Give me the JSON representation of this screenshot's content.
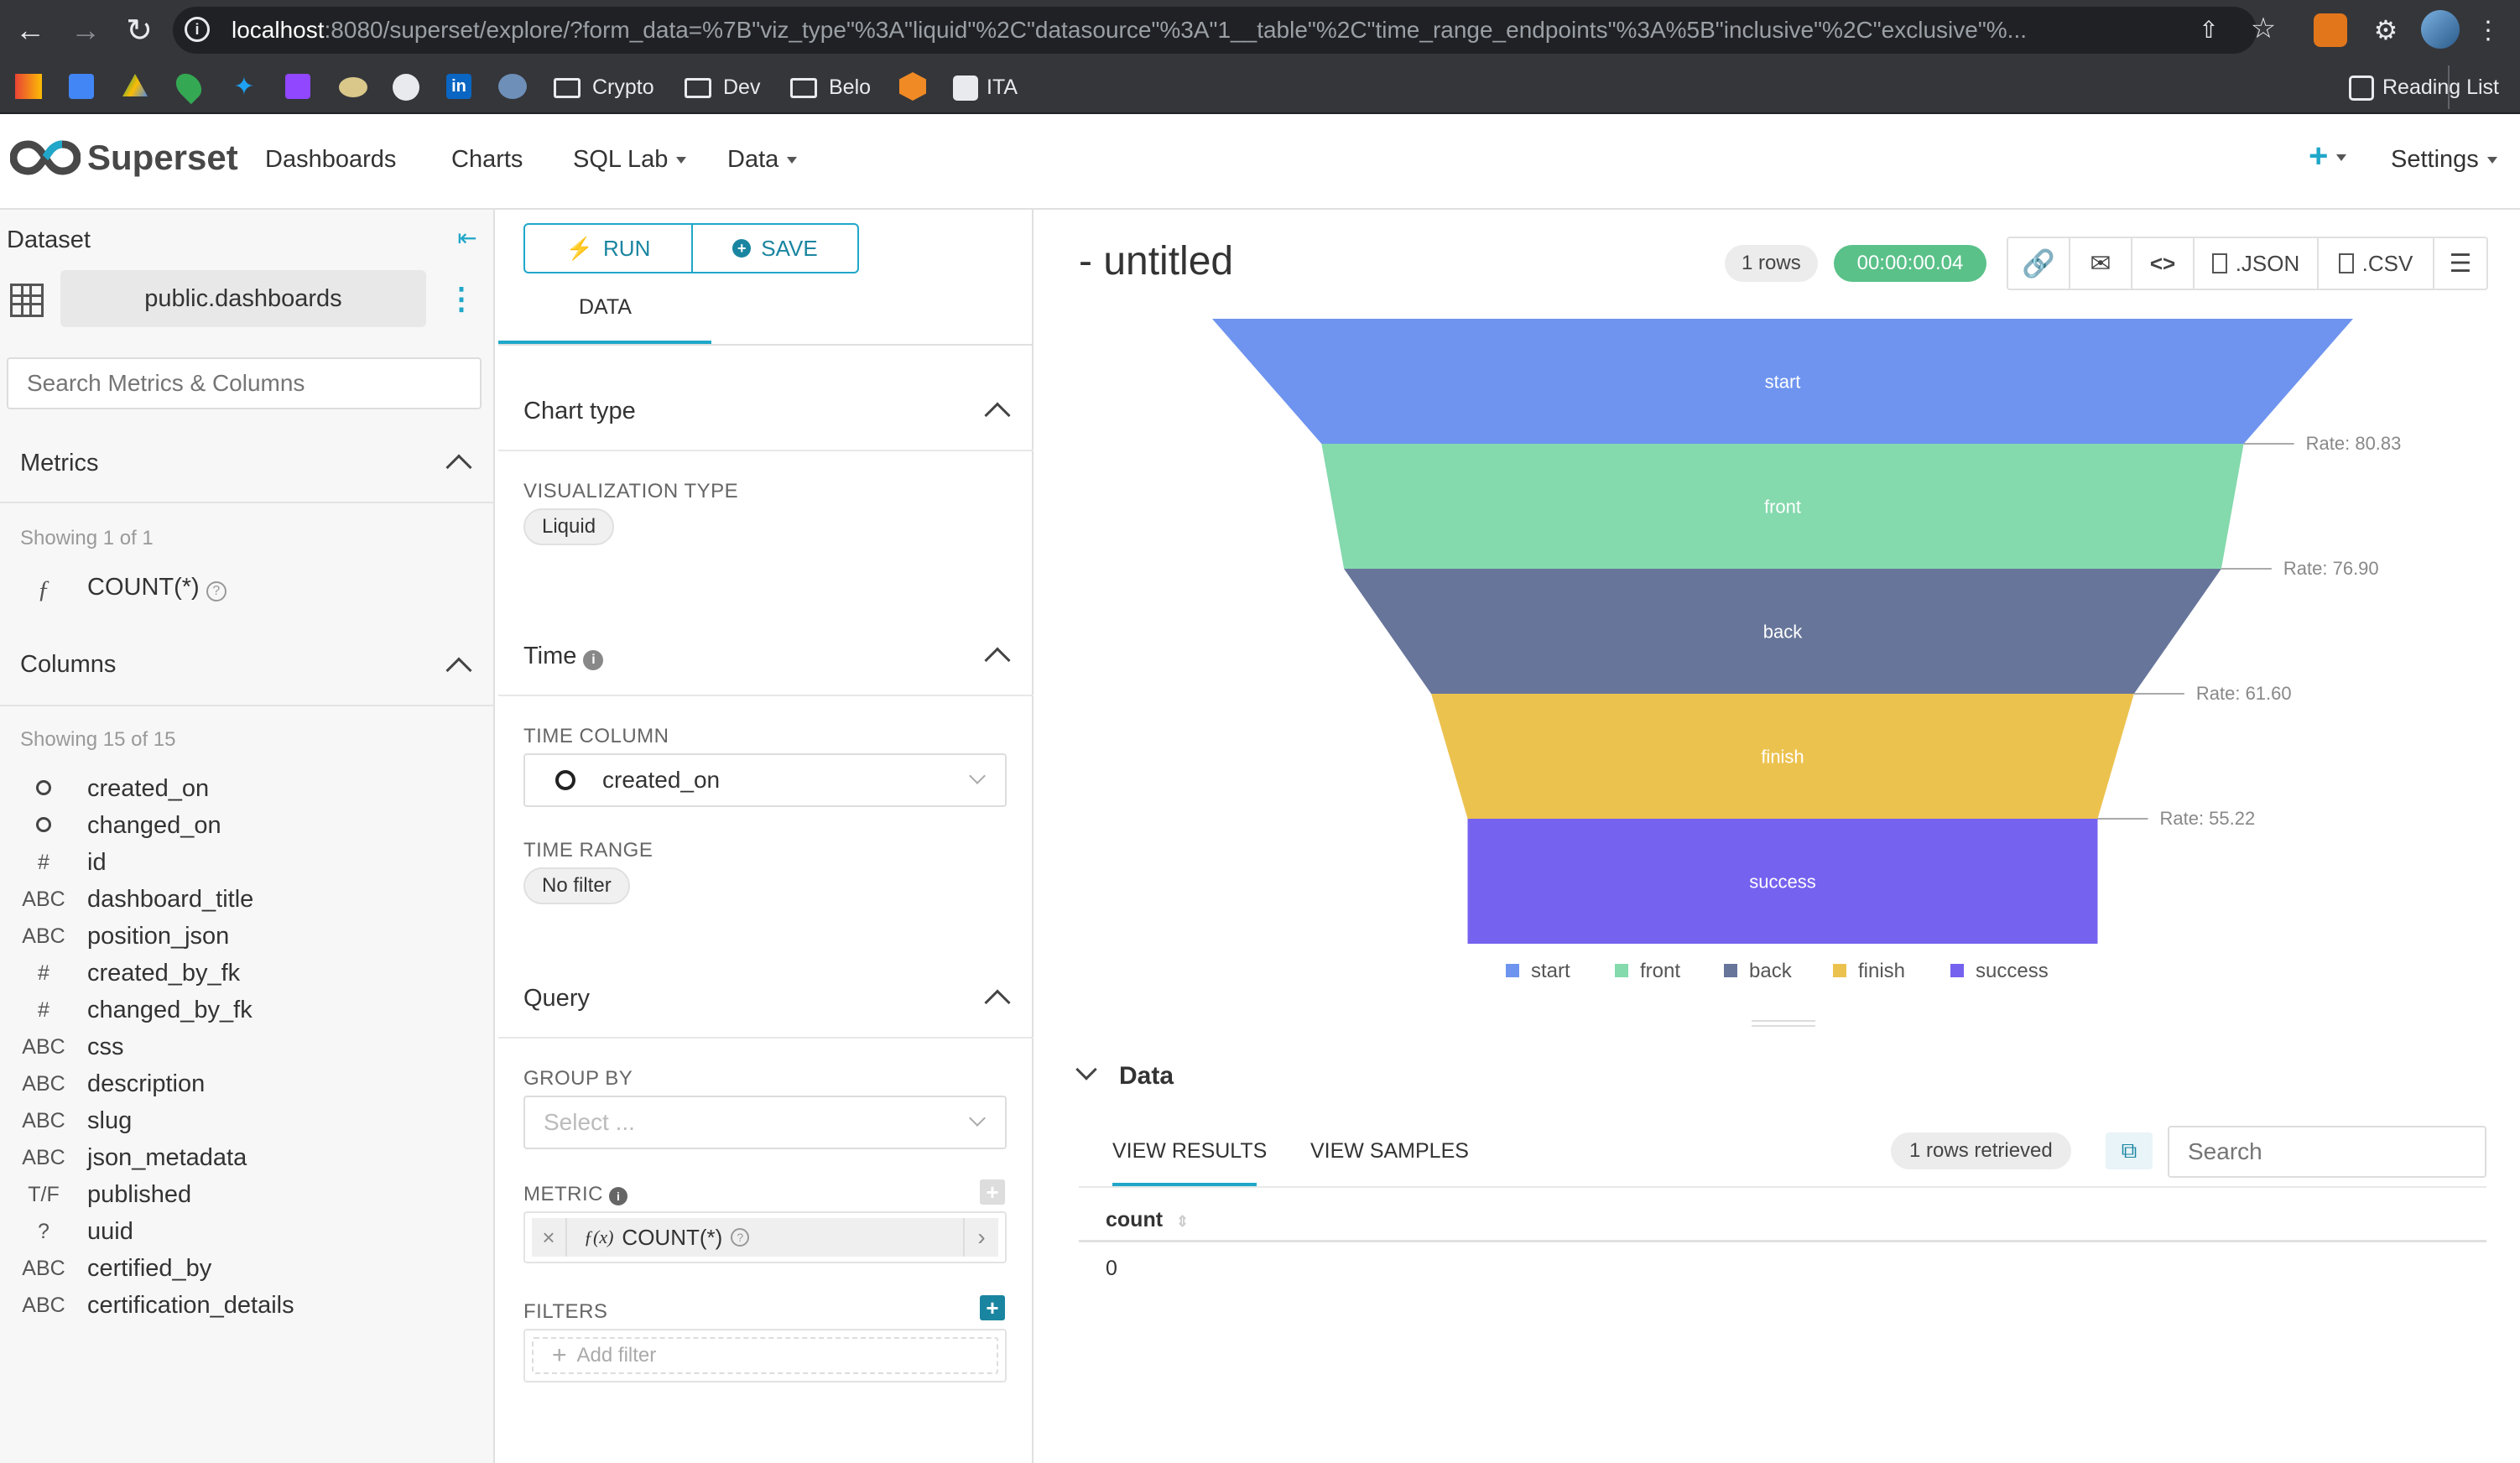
{
  "browser": {
    "url_host": "localhost",
    "url_rest": ":8080/superset/explore/?form_data=%7B\"viz_type\"%3A\"liquid\"%2C\"datasource\"%3A\"1__table\"%2C\"time_range_endpoints\"%3A%5B\"inclusive\"%2C\"exclusive\"%...",
    "bookmarks": [
      "Crypto",
      "Dev",
      "Belo",
      "ITA"
    ],
    "reading_list": "Reading List"
  },
  "app": {
    "brand": "Superset",
    "nav": [
      "Dashboards",
      "Charts",
      "SQL Lab",
      "Data"
    ],
    "plus": "+",
    "settings": "Settings"
  },
  "dataset": {
    "header": "Dataset",
    "name": "public.dashboards",
    "search_placeholder": "Search Metrics & Columns",
    "metrics_title": "Metrics",
    "metrics_showing": "Showing 1 of 1",
    "metric": {
      "type": "ƒ",
      "name": "COUNT(*)"
    },
    "columns_title": "Columns",
    "columns_showing": "Showing 15 of 15",
    "columns": [
      {
        "type": "clock",
        "name": "created_on"
      },
      {
        "type": "clock",
        "name": "changed_on"
      },
      {
        "type": "#",
        "name": "id"
      },
      {
        "type": "ABC",
        "name": "dashboard_title"
      },
      {
        "type": "ABC",
        "name": "position_json"
      },
      {
        "type": "#",
        "name": "created_by_fk"
      },
      {
        "type": "#",
        "name": "changed_by_fk"
      },
      {
        "type": "ABC",
        "name": "css"
      },
      {
        "type": "ABC",
        "name": "description"
      },
      {
        "type": "ABC",
        "name": "slug"
      },
      {
        "type": "ABC",
        "name": "json_metadata"
      },
      {
        "type": "T/F",
        "name": "published"
      },
      {
        "type": "?",
        "name": "uuid"
      },
      {
        "type": "ABC",
        "name": "certified_by"
      },
      {
        "type": "ABC",
        "name": "certification_details"
      }
    ]
  },
  "controls": {
    "run": "RUN",
    "save": "SAVE",
    "tab": "DATA",
    "chart_type_title": "Chart type",
    "viz_type_label": "VISUALIZATION TYPE",
    "viz_type": "Liquid",
    "time_title": "Time",
    "time_column_label": "TIME COLUMN",
    "time_column": "created_on",
    "time_range_label": "TIME RANGE",
    "time_range": "No filter",
    "query_title": "Query",
    "group_by_label": "GROUP BY",
    "group_by_placeholder": "Select ...",
    "metric_label": "METRIC",
    "metric_value": "COUNT(*)",
    "filters_label": "FILTERS",
    "add_filter": "Add filter"
  },
  "chart": {
    "title": "- untitled",
    "rows_badge": "1 rows",
    "timer": "00:00:00.04",
    "toolbar": {
      "json": ".JSON",
      "csv": ".CSV"
    },
    "accent": "#5ac189"
  },
  "chart_data": {
    "type": "funnel",
    "stages": [
      {
        "name": "start",
        "value": 100,
        "color": "#6e94ef",
        "rate": ""
      },
      {
        "name": "front",
        "value": 80.83,
        "color": "#84d9ad",
        "rate": "Rate: 80.83"
      },
      {
        "name": "back",
        "value": 76.9,
        "color": "#67759a",
        "rate": "Rate: 76.90"
      },
      {
        "name": "finish",
        "value": 61.6,
        "color": "#ecc24f",
        "rate": "Rate: 61.60"
      },
      {
        "name": "success",
        "value": 55.22,
        "color": "#7562ef",
        "rate": "Rate: 55.22"
      }
    ]
  },
  "data_panel": {
    "title": "Data",
    "tab_results": "VIEW RESULTS",
    "tab_samples": "VIEW SAMPLES",
    "retrieved": "1 rows retrieved",
    "search_placeholder": "Search",
    "column": "count",
    "value": "0"
  }
}
